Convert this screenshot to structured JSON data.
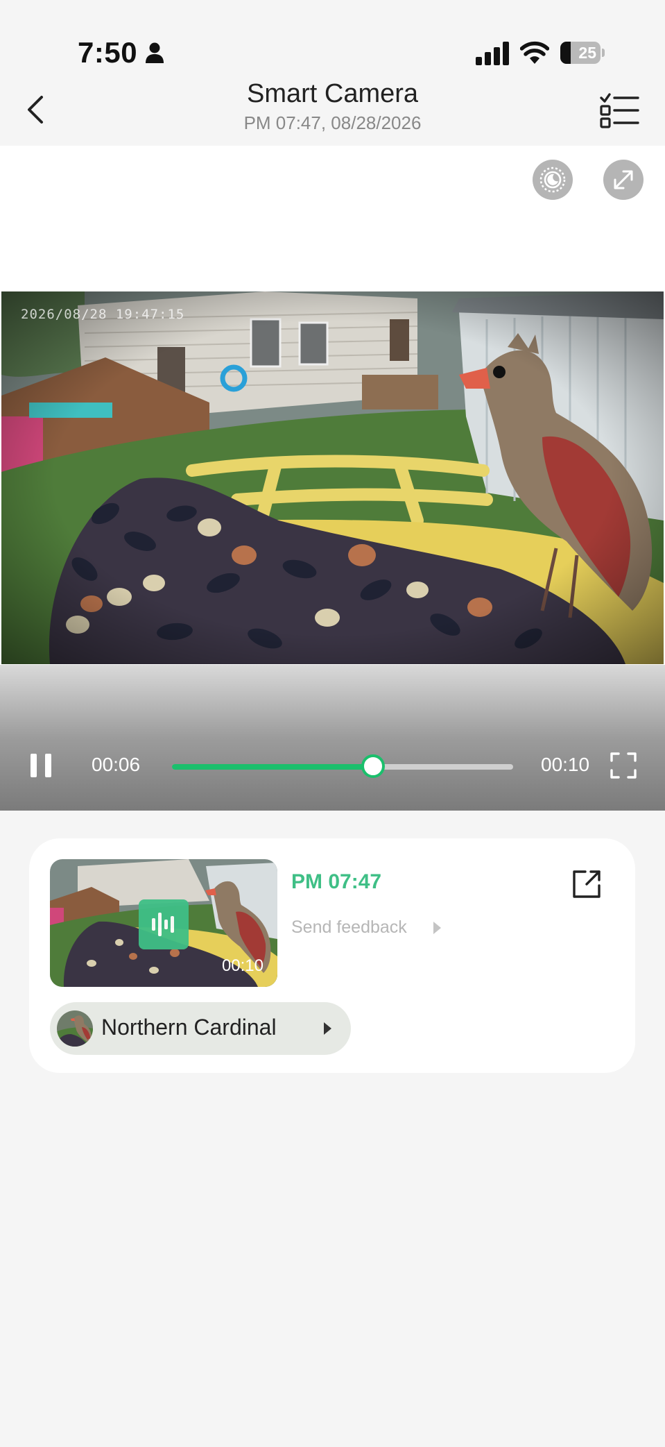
{
  "status_bar": {
    "time": "7:50",
    "battery": "25",
    "battery_level": 0.25,
    "icons": [
      "person-icon",
      "signal-icon",
      "wifi-icon",
      "battery-icon"
    ]
  },
  "header": {
    "title": "Smart Camera",
    "subtitle": "PM 07:47, 08/28/2026",
    "icons": [
      "chevron-left-icon",
      "checklist-icon"
    ]
  },
  "video": {
    "overlay_timestamp": "2026/08/28 19:47:15",
    "controls": {
      "current_time": "00:06",
      "total_time": "00:10",
      "progress": 0.59,
      "accent": "#1bbf6c"
    },
    "top_icons": [
      "night-vision-icon",
      "expand-icon"
    ]
  },
  "event": {
    "time": "PM 07:47",
    "feedback_label": "Send feedback",
    "duration": "00:10",
    "species": "Northern Cardinal",
    "accent": "#3fbf86",
    "icons": [
      "audio-wave-icon",
      "share-icon",
      "caret-right-icon"
    ]
  }
}
